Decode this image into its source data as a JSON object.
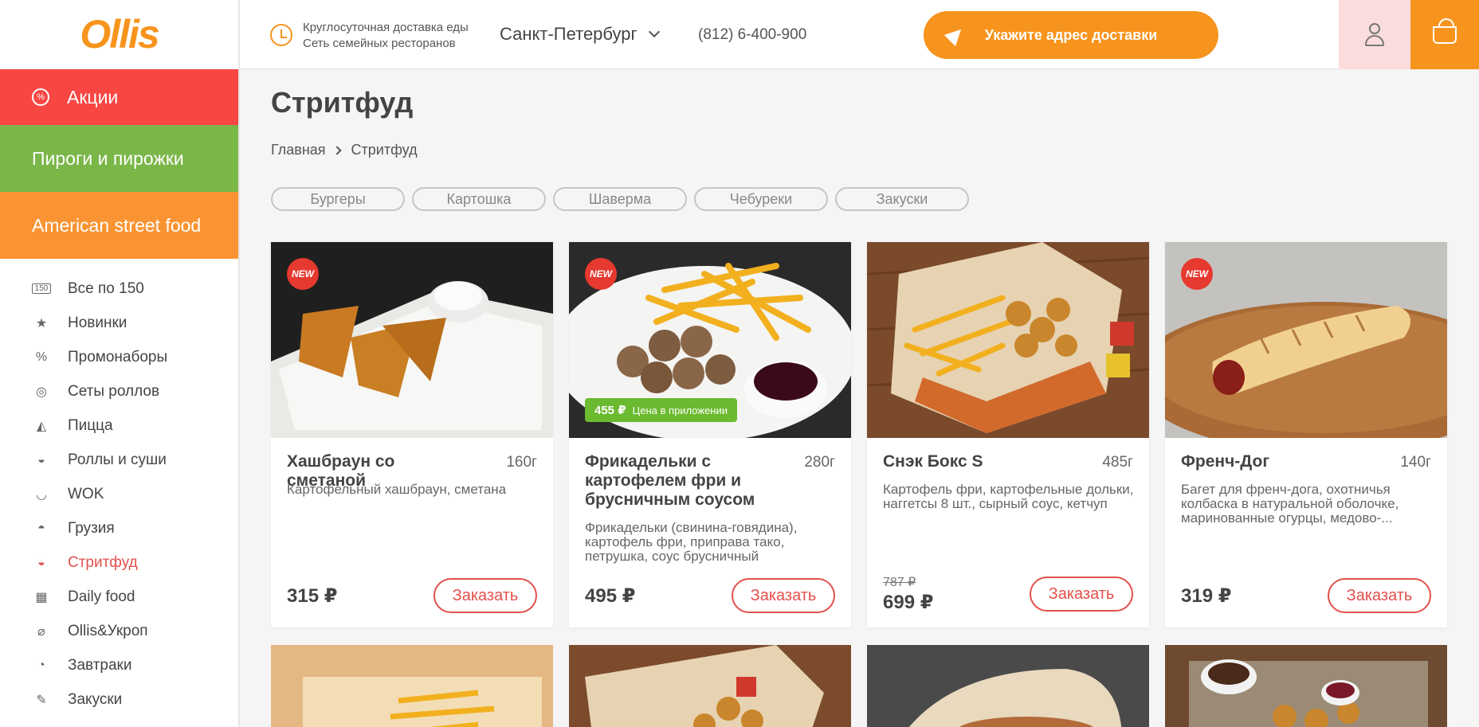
{
  "logo": "Ollis",
  "sidebar": {
    "categories": [
      {
        "label": "Акции"
      },
      {
        "label": "Пироги и пирожки"
      },
      {
        "label": "American street food"
      }
    ],
    "items": [
      {
        "label": "Все по 150",
        "icon": "150"
      },
      {
        "label": "Новинки",
        "icon": "★"
      },
      {
        "label": "Промонаборы",
        "icon": "%"
      },
      {
        "label": "Сеты роллов",
        "icon": "◎"
      },
      {
        "label": "Пицца",
        "icon": "◭"
      },
      {
        "label": "Роллы и суши",
        "icon": "◒"
      },
      {
        "label": "WOK",
        "icon": "◡"
      },
      {
        "label": "Грузия",
        "icon": "◓"
      },
      {
        "label": "Стритфуд",
        "icon": "◒"
      },
      {
        "label": "Daily food",
        "icon": "▦"
      },
      {
        "label": "Ollis&Укроп",
        "icon": "⌀"
      },
      {
        "label": "Завтраки",
        "icon": "◔"
      },
      {
        "label": "Закуски",
        "icon": "✎"
      }
    ],
    "active_index": 8
  },
  "header": {
    "tagline_1": "Круглосуточная доставка еды",
    "tagline_2": "Сеть семейных ресторанов",
    "city": "Санкт-Петербург",
    "phone": "(812) 6-400-900",
    "address_button": "Укажите адрес доставки"
  },
  "main": {
    "title": "Стритфуд",
    "breadcrumb": [
      "Главная",
      "Стритфуд"
    ],
    "filters": [
      "Бургеры",
      "Картошка",
      "Шаверма",
      "Чебуреки",
      "Закуски"
    ],
    "order_label": "Заказать",
    "new_badge": "NEW",
    "products": [
      {
        "title": "Хашбраун со сметаной",
        "weight": "160г",
        "desc": "Картофельный хашбраун, сметана",
        "price": "315 ₽",
        "old_price": "",
        "is_new": true,
        "app_price": "",
        "app_label": ""
      },
      {
        "title": "Фрикадельки с картофелем фри и брусничным соусом",
        "weight": "280г",
        "desc": "Фрикадельки (свинина-говядина), картофель фри, приправа тако, петрушка, соус брусничный",
        "price": "495 ₽",
        "old_price": "",
        "is_new": true,
        "app_price": "455 ₽",
        "app_label": "Цена в приложении"
      },
      {
        "title": "Снэк Бокс S",
        "weight": "485г",
        "desc": "Картофель фри, картофельные дольки, наггетсы 8 шт., сырный соус, кетчуп",
        "price": "699 ₽",
        "old_price": "787 ₽",
        "is_new": false,
        "app_price": "",
        "app_label": ""
      },
      {
        "title": "Френч-Дог",
        "weight": "140г",
        "desc": "Багет для френч-дога, охотничья колбаска в натуральной оболочке, маринованные огурцы, медово-...",
        "price": "319 ₽",
        "old_price": "",
        "is_new": true,
        "app_price": "",
        "app_label": ""
      }
    ]
  },
  "colors": {
    "brand_orange": "#f7941d",
    "promo_red": "#f84643",
    "pies_green": "#7ab648",
    "accent_red": "#e3504b"
  }
}
